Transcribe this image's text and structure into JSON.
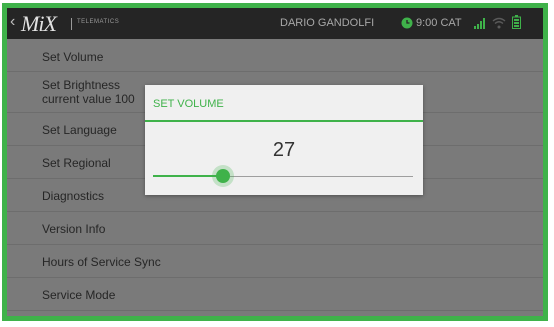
{
  "header": {
    "logo_text": "MiX",
    "logo_sub": "TELEMATICS",
    "user_name": "DARIO GANDOLFI",
    "time": "9:00 CAT",
    "icons": [
      "back-chevron-icon",
      "clock-icon",
      "signal-icon",
      "wifi-icon",
      "battery-icon"
    ]
  },
  "menu": {
    "items": [
      {
        "label": "Set Volume"
      },
      {
        "label": "Set Brightness",
        "sub": "current value 100"
      },
      {
        "label": "Set Language"
      },
      {
        "label": "Set Regional"
      },
      {
        "label": "Diagnostics"
      },
      {
        "label": "Version Info"
      },
      {
        "label": "Hours of Service Sync"
      },
      {
        "label": "Service Mode"
      }
    ]
  },
  "dialog": {
    "title": "SET VOLUME",
    "value": "27",
    "slider_fraction": 0.27
  },
  "colors": {
    "accent": "#3fb24a",
    "topbar": "#252525",
    "list_bg": "#7a7a7a",
    "dialog_bg": "#f0f0f0"
  }
}
